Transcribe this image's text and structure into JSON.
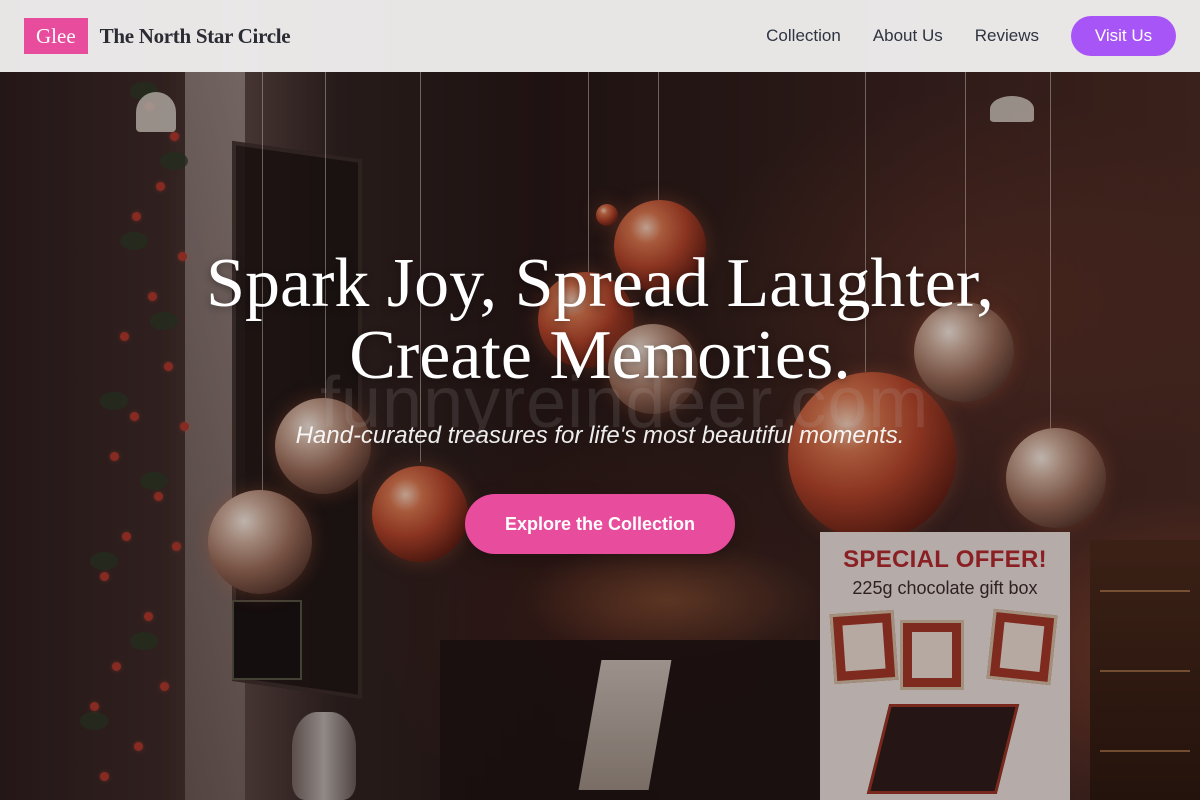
{
  "navbar": {
    "logo_text": "Glee",
    "brand_name": "The North Star Circle",
    "links": [
      "Collection",
      "About Us",
      "Reviews"
    ],
    "cta_label": "Visit Us",
    "colors": {
      "logo_badge": "#e84c9c",
      "cta": "#a855f7"
    }
  },
  "hero": {
    "title": "Spark Joy, Spread Laughter, Create Memories.",
    "subtitle": "Hand-curated treasures for life's most beautiful moments.",
    "cta_label": "Explore the Collection",
    "cta_color": "#e84c9c",
    "background": {
      "watermark": "funnyreindeer.com",
      "poster_title": "SPECIAL OFFER!",
      "poster_subtitle": "225g chocolate gift box"
    }
  }
}
